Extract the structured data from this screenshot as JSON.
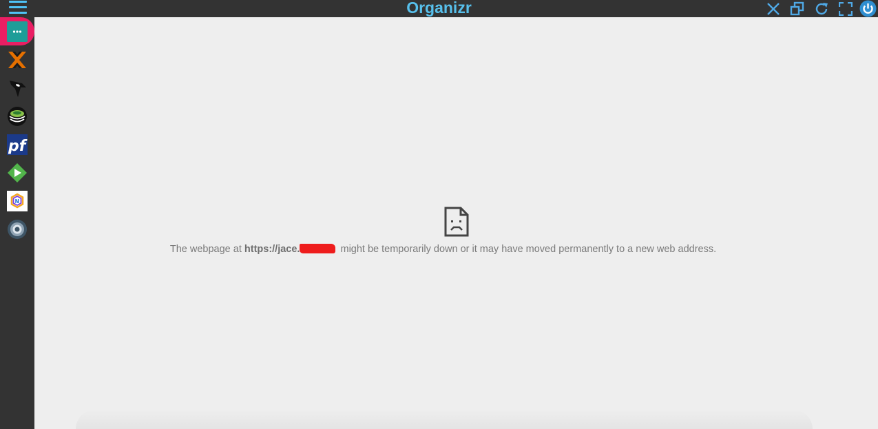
{
  "app": {
    "title": "Organizr"
  },
  "topbar": {
    "menu_icon": "hamburger-icon",
    "actions": [
      {
        "icon": "close-icon",
        "name": "close-tab-button"
      },
      {
        "icon": "restore-window-icon",
        "name": "open-new-window-button"
      },
      {
        "icon": "reload-icon",
        "name": "reload-button"
      },
      {
        "icon": "fullscreen-icon",
        "name": "fullscreen-button"
      },
      {
        "icon": "power-icon",
        "name": "logout-button"
      }
    ],
    "accent_color": "#57c0ec"
  },
  "sidebar": {
    "active_color": "#e91e63",
    "items": [
      {
        "icon": "more-dots-icon",
        "active": true
      },
      {
        "icon": "proxmox-icon",
        "active": false
      },
      {
        "icon": "kodi-bird-icon",
        "active": false
      },
      {
        "icon": "sickrage-bowl-icon",
        "active": false
      },
      {
        "icon": "pfsense-icon",
        "active": false
      },
      {
        "icon": "emby-play-icon",
        "active": false
      },
      {
        "icon": "nextcloud-hex-icon",
        "active": false
      },
      {
        "icon": "settings-gear-icon",
        "active": false
      }
    ]
  },
  "error": {
    "icon": "sad-document-icon",
    "prefix": "The webpage at ",
    "url": "https://jace.",
    "suffix": " might be temporarily down or it may have moved permanently to a new web address."
  }
}
